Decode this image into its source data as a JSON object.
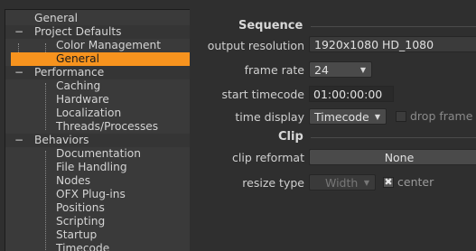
{
  "sidebar": {
    "items": [
      {
        "label": "General",
        "level": 0
      },
      {
        "label": "Project Defaults",
        "level": 0,
        "expander": "−"
      },
      {
        "label": "Color Management",
        "level": 1
      },
      {
        "label": "General",
        "level": 1,
        "selected": true
      },
      {
        "label": "Performance",
        "level": 0,
        "expander": "−"
      },
      {
        "label": "Caching",
        "level": 1
      },
      {
        "label": "Hardware",
        "level": 1
      },
      {
        "label": "Localization",
        "level": 1
      },
      {
        "label": "Threads/Processes",
        "level": 1
      },
      {
        "label": "Behaviors",
        "level": 0,
        "expander": "−"
      },
      {
        "label": "Documentation",
        "level": 1
      },
      {
        "label": "File Handling",
        "level": 1
      },
      {
        "label": "Nodes",
        "level": 1
      },
      {
        "label": "OFX Plug-ins",
        "level": 1
      },
      {
        "label": "Positions",
        "level": 1
      },
      {
        "label": "Scripting",
        "level": 1
      },
      {
        "label": "Startup",
        "level": 1
      },
      {
        "label": "Timecode",
        "level": 1
      }
    ]
  },
  "sequence": {
    "title": "Sequence",
    "output_resolution_label": "output resolution",
    "output_resolution_value": "1920x1080 HD_1080",
    "frame_rate_label": "frame rate",
    "frame_rate_value": "24",
    "start_timecode_label": "start timecode",
    "start_timecode_value": "01:00:00:00",
    "time_display_label": "time display",
    "time_display_value": "Timecode",
    "drop_frame_label": "drop frame",
    "drop_frame_checked": false
  },
  "clip": {
    "title": "Clip",
    "clip_reformat_label": "clip reformat",
    "clip_reformat_value": "None",
    "resize_type_label": "resize type",
    "resize_type_value": "Width",
    "center_label": "center",
    "center_checked": true,
    "center_mark": "✖"
  },
  "colors": {
    "selection": "#f7931e",
    "background": "#2f2f2f"
  }
}
